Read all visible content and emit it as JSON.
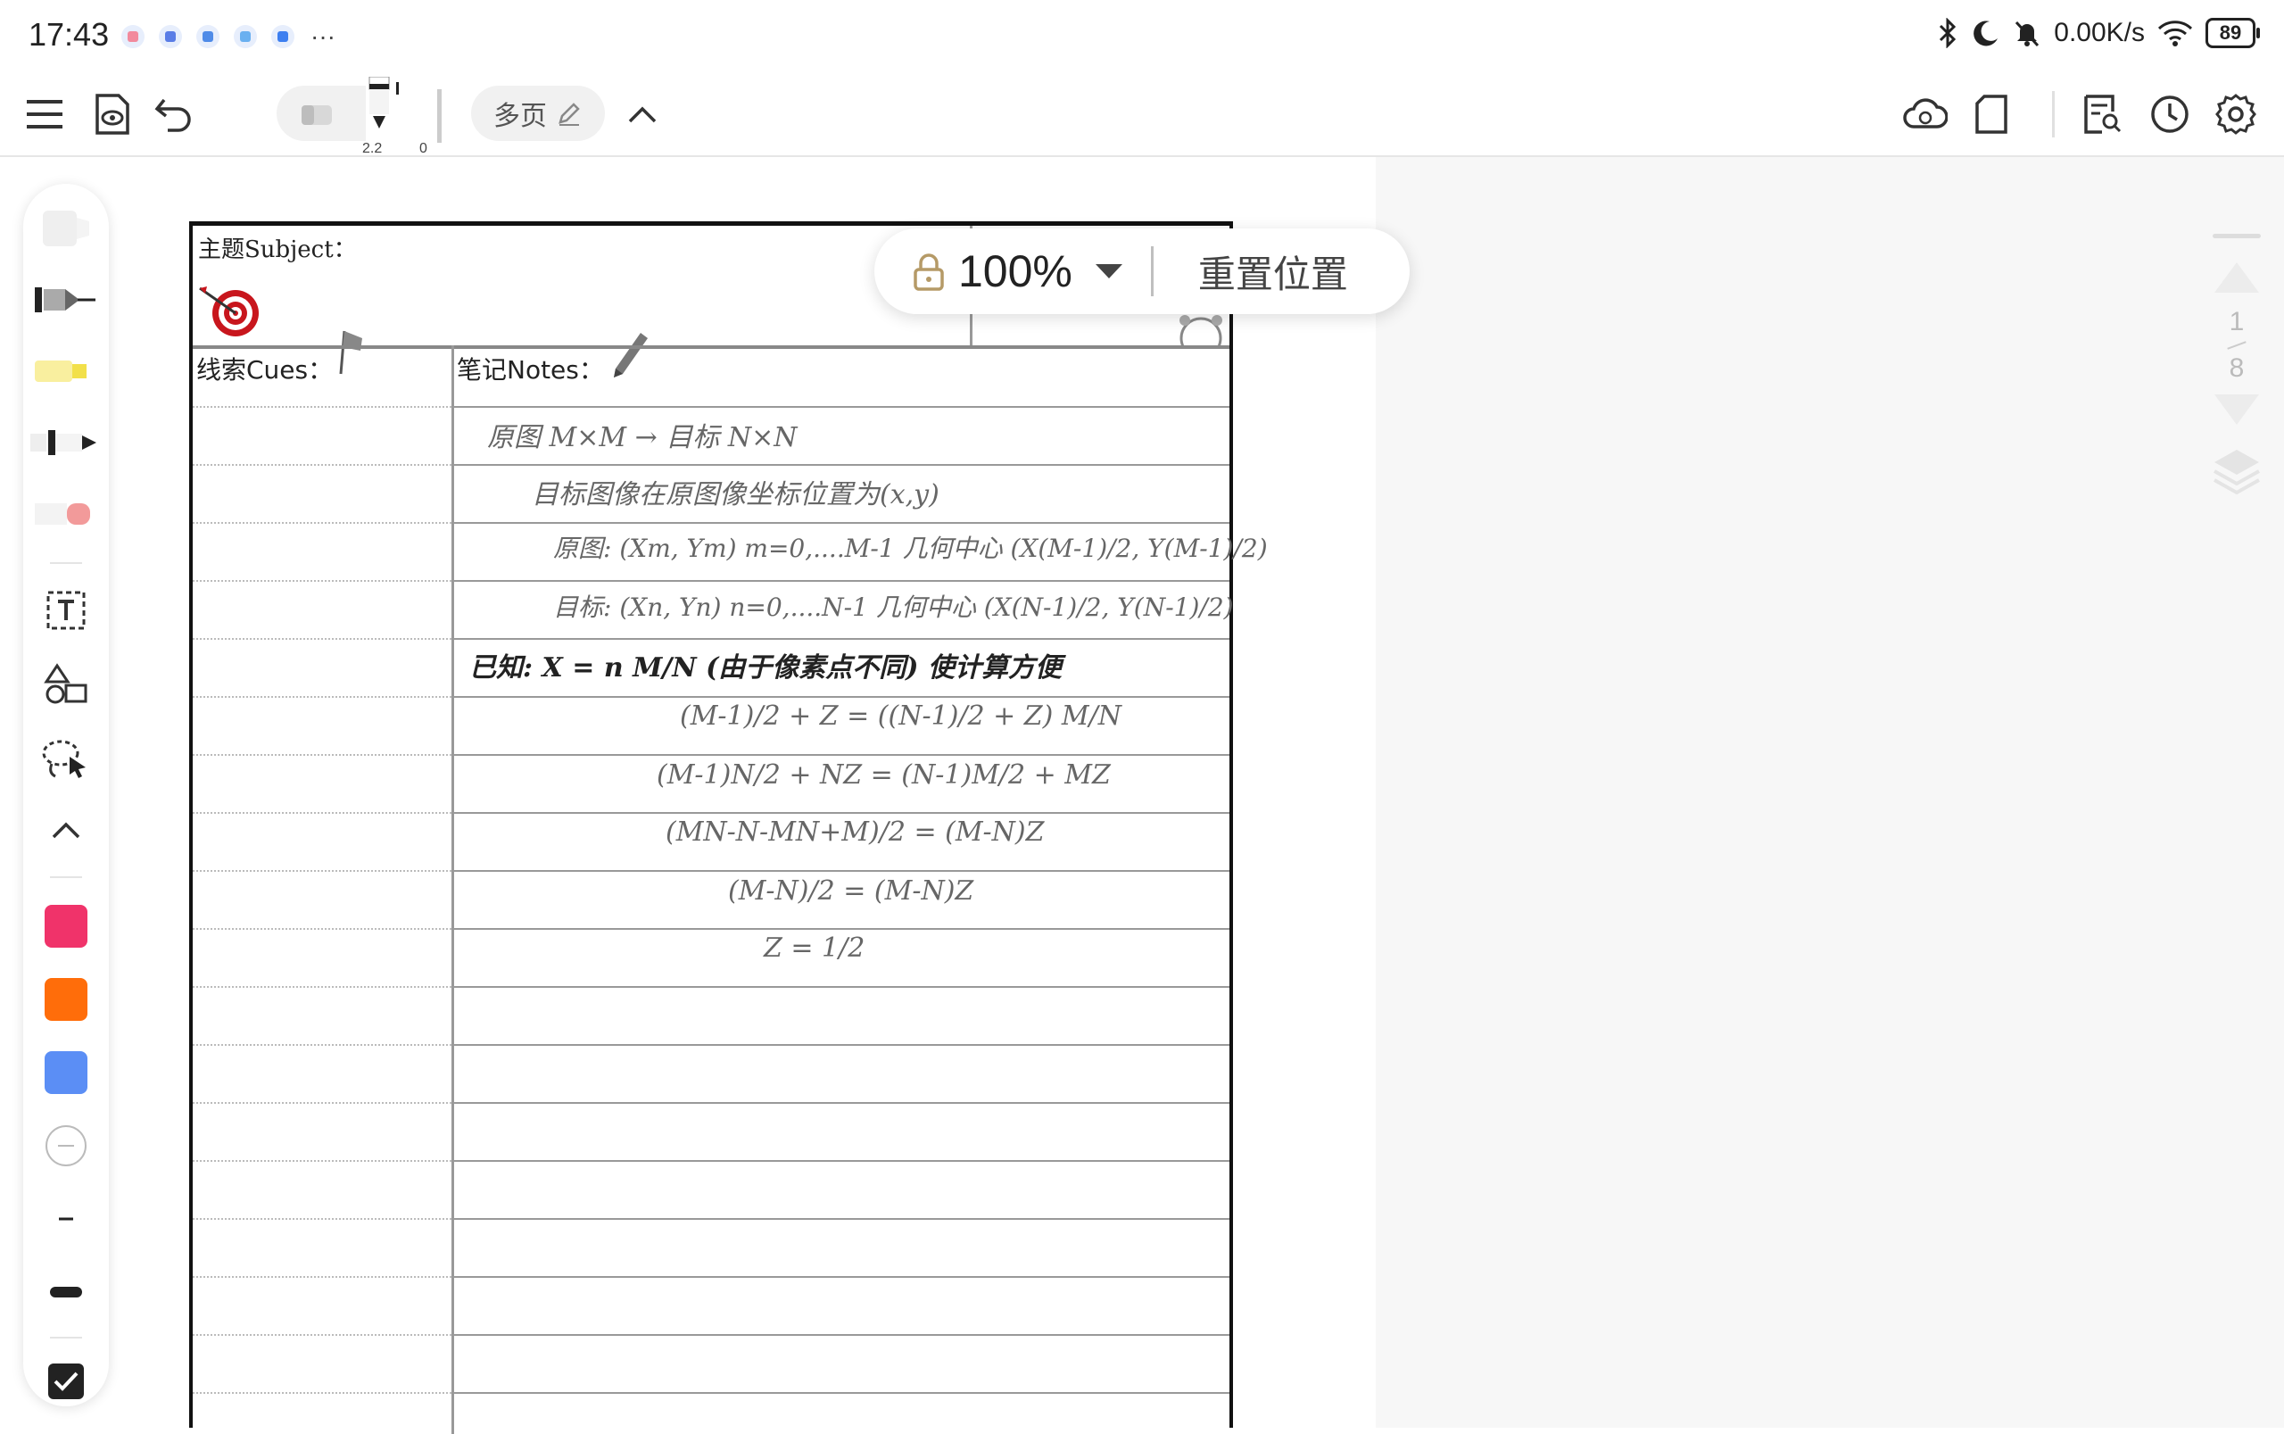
{
  "status_bar": {
    "time": "17:43",
    "more": "···",
    "net_speed": "0.00K/s",
    "battery": "89"
  },
  "toolbar": {
    "page_mode_label": "多页",
    "pen_size_a": "2.2",
    "pen_size_b": "0"
  },
  "zoom": {
    "value": "100%",
    "reset_label": "重置位置"
  },
  "page_nav": {
    "current": "1",
    "total": "8"
  },
  "palette": {
    "colors": [
      "#f0336a",
      "#ff6d0a",
      "#5b8ef5"
    ]
  },
  "paper": {
    "subject_label": "主题Subject：",
    "cues_label": "线索Cues：",
    "notes_label": "笔记Notes："
  },
  "handwriting": [
    "原图 M×M → 目标 N×N",
    "目标图像在原图像坐标位置为(x,y)",
    "原图: (Xm, Ym)   m=0,....M-1     几何中心 (X(M-1)/2, Y(M-1)/2)",
    "目标: (Xn, Yn)   n=0,....N-1     几何中心 (X(N-1)/2, Y(N-1)/2)",
    "已知:  X = n M/N (由于像素点不同) 使计算方便",
    "(M-1)/2 + Z = ((N-1)/2 + Z) M/N",
    "(M-1)N/2 + NZ = (N-1)M/2 + MZ",
    "(MN-N-MN+M)/2 = (M-N)Z",
    "(M-N)/2 = (M-N)Z",
    "Z = 1/2"
  ]
}
